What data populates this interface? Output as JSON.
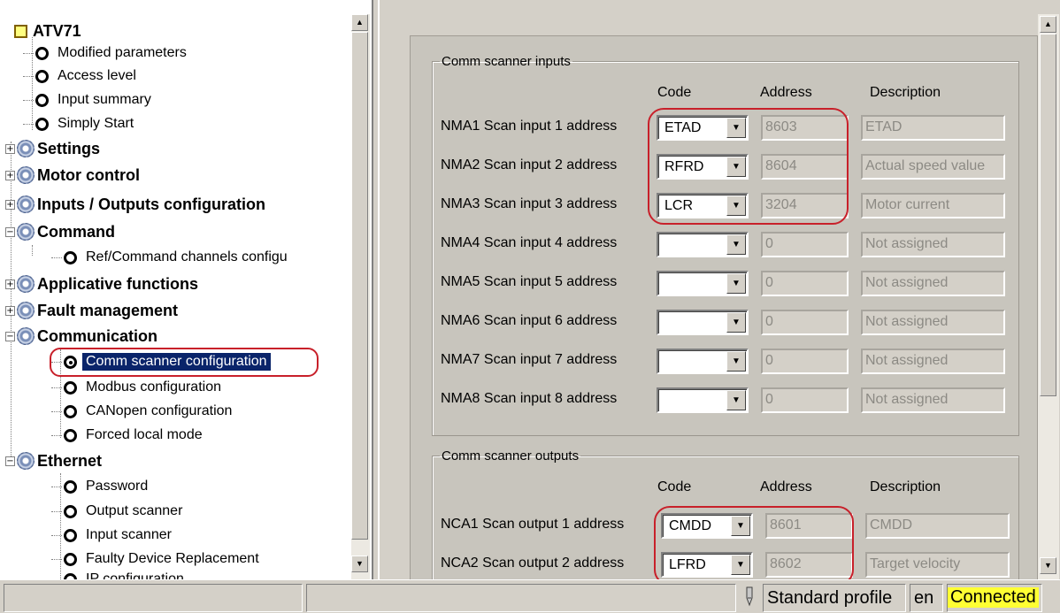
{
  "tree": {
    "root": "ATV71",
    "items": [
      {
        "label": "Modified parameters"
      },
      {
        "label": "Access level"
      },
      {
        "label": "Input summary"
      },
      {
        "label": "Simply Start"
      },
      {
        "label": "Settings"
      },
      {
        "label": "Motor control"
      },
      {
        "label": "Inputs / Outputs configuration"
      },
      {
        "label": "Command"
      },
      {
        "label": "Ref/Command channels configu"
      },
      {
        "label": "Applicative functions"
      },
      {
        "label": "Fault management"
      },
      {
        "label": "Communication"
      },
      {
        "label": "Comm scanner configuration"
      },
      {
        "label": "Modbus configuration"
      },
      {
        "label": "CANopen configuration"
      },
      {
        "label": "Forced local mode"
      },
      {
        "label": "Ethernet"
      },
      {
        "label": "Password"
      },
      {
        "label": "Output scanner"
      },
      {
        "label": "Input scanner"
      },
      {
        "label": "Faulty Device Replacement"
      },
      {
        "label": "IP configuration"
      }
    ]
  },
  "inputs": {
    "legend": "Comm scanner inputs",
    "headers": {
      "code": "Code",
      "address": "Address",
      "description": "Description"
    },
    "rows": [
      {
        "label": "NMA1 Scan input 1 address",
        "code": "ETAD",
        "address": "8603",
        "description": "ETAD"
      },
      {
        "label": "NMA2 Scan input 2 address",
        "code": "RFRD",
        "address": "8604",
        "description": "Actual speed value"
      },
      {
        "label": "NMA3 Scan input 3 address",
        "code": "LCR",
        "address": "3204",
        "description": "Motor current"
      },
      {
        "label": "NMA4 Scan input 4 address",
        "code": "",
        "address": "0",
        "description": "Not assigned"
      },
      {
        "label": "NMA5 Scan input 5 address",
        "code": "",
        "address": "0",
        "description": "Not assigned"
      },
      {
        "label": "NMA6 Scan input 6 address",
        "code": "",
        "address": "0",
        "description": "Not assigned"
      },
      {
        "label": "NMA7 Scan input 7 address",
        "code": "",
        "address": "0",
        "description": "Not assigned"
      },
      {
        "label": "NMA8 Scan input 8 address",
        "code": "",
        "address": "0",
        "description": "Not assigned"
      }
    ]
  },
  "outputs": {
    "legend": "Comm scanner outputs",
    "headers": {
      "code": "Code",
      "address": "Address",
      "description": "Description"
    },
    "rows": [
      {
        "label": "NCA1 Scan output 1 address",
        "code": "CMDD",
        "address": "8601",
        "description": "CMDD"
      },
      {
        "label": "NCA2 Scan output 2 address",
        "code": "LFRD",
        "address": "8602",
        "description": "Target velocity"
      }
    ]
  },
  "status": {
    "profile": "Standard profile",
    "lang": "en",
    "connection": "Connected",
    "connection_color": "#ffff33"
  },
  "icons": {
    "tree_leaf": "radio-circle-icon",
    "tree_folder": "gear-icon",
    "status_pen": "pen-icon"
  }
}
